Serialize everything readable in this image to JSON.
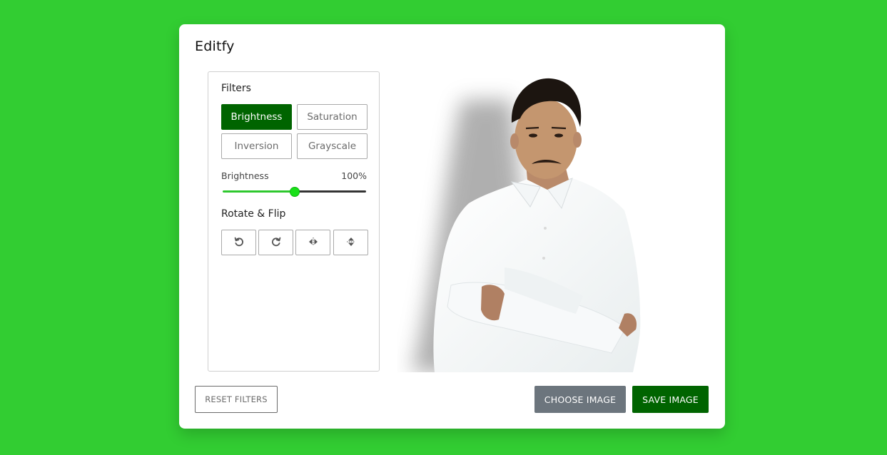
{
  "app": {
    "title": "Editfy"
  },
  "filters": {
    "heading": "Filters",
    "buttons": [
      {
        "label": "Brightness",
        "active": true
      },
      {
        "label": "Saturation",
        "active": false
      },
      {
        "label": "Inversion",
        "active": false
      },
      {
        "label": "Grayscale",
        "active": false
      }
    ],
    "slider": {
      "name": "Brightness",
      "value_text": "100%",
      "value": 100,
      "min": 0,
      "max": 200
    }
  },
  "rotate_flip": {
    "heading": "Rotate & Flip",
    "buttons": [
      {
        "icon": "rotate-left-icon"
      },
      {
        "icon": "rotate-right-icon"
      },
      {
        "icon": "flip-horizontal-icon"
      },
      {
        "icon": "flip-vertical-icon"
      }
    ]
  },
  "actions": {
    "reset_label": "RESET FILTERS",
    "choose_label": "CHOOSE IMAGE",
    "save_label": "SAVE IMAGE"
  },
  "colors": {
    "background": "#32cd32",
    "accent": "#006400",
    "secondary": "#6c757d",
    "slider_fill": "#2ec82e"
  }
}
